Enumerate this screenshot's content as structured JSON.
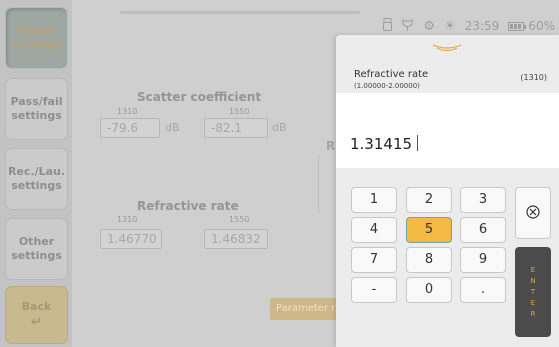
{
  "sidebar": {
    "items": [
      {
        "label": "Param settings"
      },
      {
        "label": "Pass/fail settings"
      },
      {
        "label": "Rec./Lau. settings"
      },
      {
        "label": "Other settings"
      }
    ],
    "back_label": "Back"
  },
  "status": {
    "time": "23:59",
    "battery": "60%",
    "icons": [
      "usb-icon",
      "plug-icon",
      "gear-icon",
      "sun-icon",
      "battery-icon"
    ]
  },
  "scatter": {
    "title": "Scatter coefficient",
    "wl1": "1310",
    "wl2": "1550",
    "val1": "-79.6",
    "val2": "-82.1",
    "unit1": "dB",
    "unit2": "dB"
  },
  "refractive": {
    "title": "Refractive rate",
    "wl1": "1310",
    "wl2": "1550",
    "val1": "1.46770",
    "val2": "1.46832"
  },
  "partial_label": "R",
  "parameter_button": "Parameter r",
  "keypad": {
    "field_title": "Refractive rate",
    "field_range": "(1.00000-2.00000)",
    "field_wavelength": "(1310)",
    "entry_value": "1.31415",
    "keys": [
      "1",
      "2",
      "3",
      "4",
      "5",
      "6",
      "7",
      "8",
      "9",
      "-",
      "0",
      "."
    ],
    "highlighted_key": "5",
    "enter_label": "ENTER",
    "accent_color": "#f4b942"
  }
}
